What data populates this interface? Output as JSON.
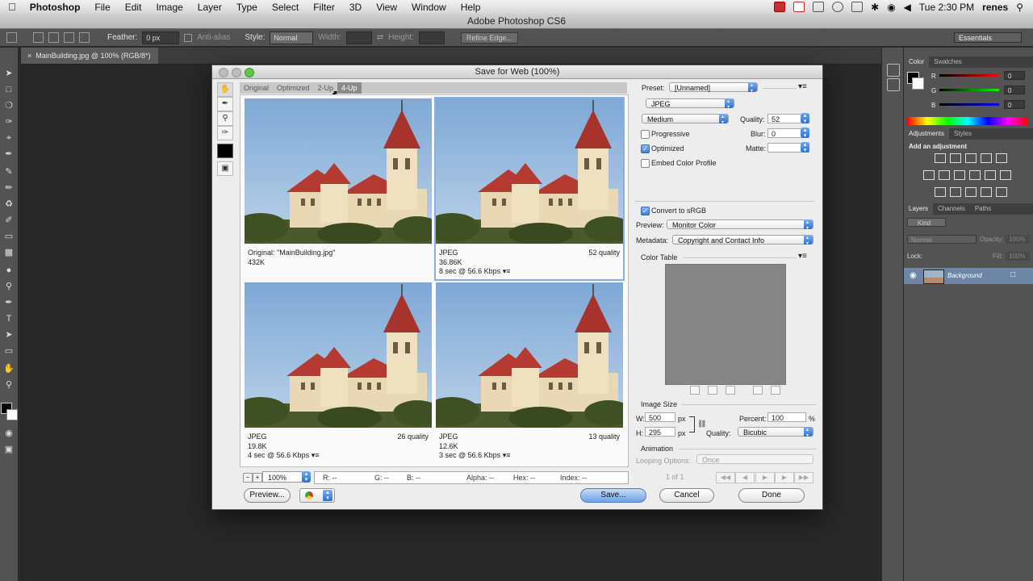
{
  "menubar": {
    "apple": "",
    "app": "Photoshop",
    "items": [
      "File",
      "Edit",
      "Image",
      "Layer",
      "Type",
      "Select",
      "Filter",
      "3D",
      "View",
      "Window",
      "Help"
    ],
    "clock": "Tue 2:30 PM",
    "user": "renes"
  },
  "app": {
    "title": "Adobe Photoshop CS6",
    "doc_tab": "MainBuilding.jpg @ 100% (RGB/8*)",
    "workspace": "Essentials"
  },
  "options": {
    "feather_label": "Feather:",
    "feather_value": "0 px",
    "antialias_label": "Anti-alias",
    "style_label": "Style:",
    "style_value": "Normal",
    "width_label": "Width:",
    "height_label": "Height:",
    "refine_edge": "Refine Edge..."
  },
  "color_panel": {
    "tabs": [
      "Color",
      "Swatches"
    ],
    "r_label": "R",
    "g_label": "G",
    "b_label": "B",
    "r": "0",
    "g": "0",
    "b": "0"
  },
  "adjustments": {
    "tabs": [
      "Adjustments",
      "Styles"
    ],
    "heading": "Add an adjustment"
  },
  "layers": {
    "tabs": [
      "Layers",
      "Channels",
      "Paths"
    ],
    "kind": "Kind",
    "blend": "Normal",
    "opacity_label": "Opacity:",
    "opacity": "100%",
    "lock_label": "Lock:",
    "fill_label": "Fill:",
    "fill": "100%",
    "layer_name": "Background"
  },
  "dialog": {
    "title": "Save for Web (100%)",
    "tabs": [
      "Original",
      "Optimized",
      "2-Up",
      "4-Up"
    ],
    "active_tab": "4-Up",
    "previews": [
      {
        "line1": "Original: \"MainBuilding.jpg\"",
        "line2": "432K",
        "line3": "",
        "quality": ""
      },
      {
        "line1": "JPEG",
        "line2": "36.86K",
        "line3": "8 sec @ 56.6 Kbps",
        "quality": "52 quality"
      },
      {
        "line1": "JPEG",
        "line2": "19.8K",
        "line3": "4 sec @ 56.6 Kbps",
        "quality": "26 quality"
      },
      {
        "line1": "JPEG",
        "line2": "12.6K",
        "line3": "3 sec @ 56.6 Kbps",
        "quality": "13 quality"
      }
    ],
    "menu_glyph": "▾≡",
    "zoom": "100%",
    "readout": {
      "r": "R: --",
      "g": "G: --",
      "b": "B: --",
      "alpha": "Alpha: --",
      "hex": "Hex: --",
      "index": "Index: --"
    },
    "buttons": {
      "preview": "Preview...",
      "save": "Save...",
      "cancel": "Cancel",
      "done": "Done"
    },
    "settings": {
      "preset_label": "Preset:",
      "preset": "[Unnamed]",
      "format": "JPEG",
      "compression": "Medium",
      "quality_label": "Quality:",
      "quality": "52",
      "progressive": "Progressive",
      "blur_label": "Blur:",
      "blur": "0",
      "optimized": "Optimized",
      "matte_label": "Matte:",
      "embed_profile": "Embed Color Profile",
      "convert_srgb": "Convert to sRGB",
      "preview_label": "Preview:",
      "preview_value": "Monitor Color",
      "metadata_label": "Metadata:",
      "metadata_value": "Copyright and Contact Info",
      "color_table": "Color Table",
      "image_size": "Image Size",
      "w_label": "W:",
      "w": "500",
      "h_label": "H:",
      "h": "295",
      "px": "px",
      "percent_label": "Percent:",
      "percent": "100",
      "percent_sign": "%",
      "resample_label": "Quality:",
      "resample": "Bicubic",
      "animation": "Animation",
      "looping_label": "Looping Options:",
      "looping": "Once",
      "frame": "1 of 1"
    }
  }
}
